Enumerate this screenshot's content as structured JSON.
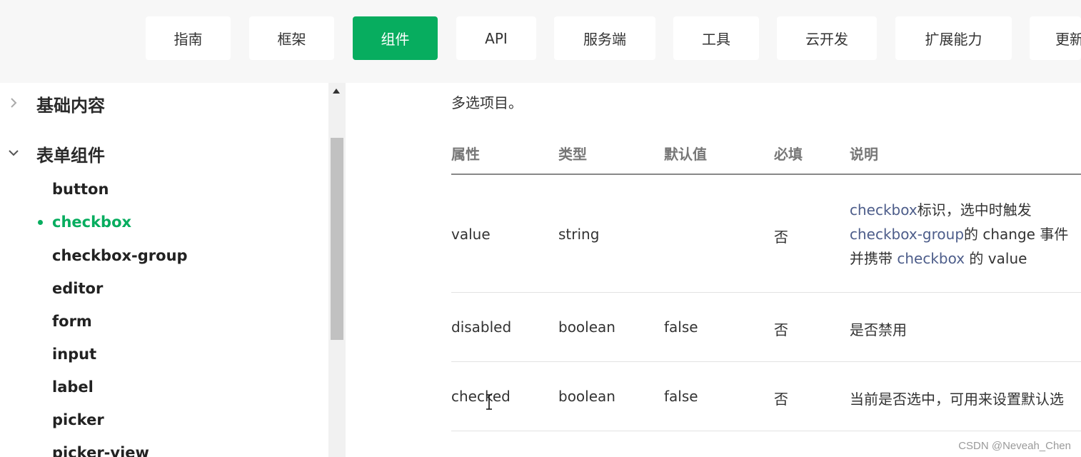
{
  "nav": {
    "tabs": [
      {
        "label": "指南"
      },
      {
        "label": "框架"
      },
      {
        "label": "组件",
        "active": true
      },
      {
        "label": "API"
      },
      {
        "label": "服务端"
      },
      {
        "label": "工具"
      },
      {
        "label": "云开发"
      },
      {
        "label": "扩展能力"
      },
      {
        "label": "更新"
      }
    ],
    "active_color": "#07ad5f"
  },
  "sidebar": {
    "categories": [
      {
        "label": "基础内容",
        "expanded": false
      },
      {
        "label": "表单组件",
        "expanded": true
      }
    ],
    "items": [
      {
        "label": "button"
      },
      {
        "label": "checkbox",
        "active": true
      },
      {
        "label": "checkbox-group"
      },
      {
        "label": "editor"
      },
      {
        "label": "form"
      },
      {
        "label": "input"
      },
      {
        "label": "label"
      },
      {
        "label": "picker"
      },
      {
        "label": "picker-view"
      }
    ]
  },
  "main": {
    "intro": "多选项目。",
    "table": {
      "headers": [
        "属性",
        "类型",
        "默认值",
        "必填",
        "说明"
      ],
      "rows": [
        {
          "name": "value",
          "type": "string",
          "default": "",
          "required": "否",
          "desc": {
            "line1_link": "checkbox",
            "line1_text": "标识，选中时触发",
            "line2_link": "checkbox-group",
            "line2_text": "的 change 事件",
            "line3_pre": "并携带 ",
            "line3_link": "checkbox",
            "line3_post": " 的 value"
          }
        },
        {
          "name": "disabled",
          "type": "boolean",
          "default": "false",
          "required": "否",
          "desc_text": "是否禁用"
        },
        {
          "name": "checked",
          "type": "boolean",
          "default": "false",
          "required": "否",
          "desc_text": "当前是否选中，可用来设置默认选"
        }
      ]
    }
  },
  "watermark": "CSDN @Neveah_Chen"
}
